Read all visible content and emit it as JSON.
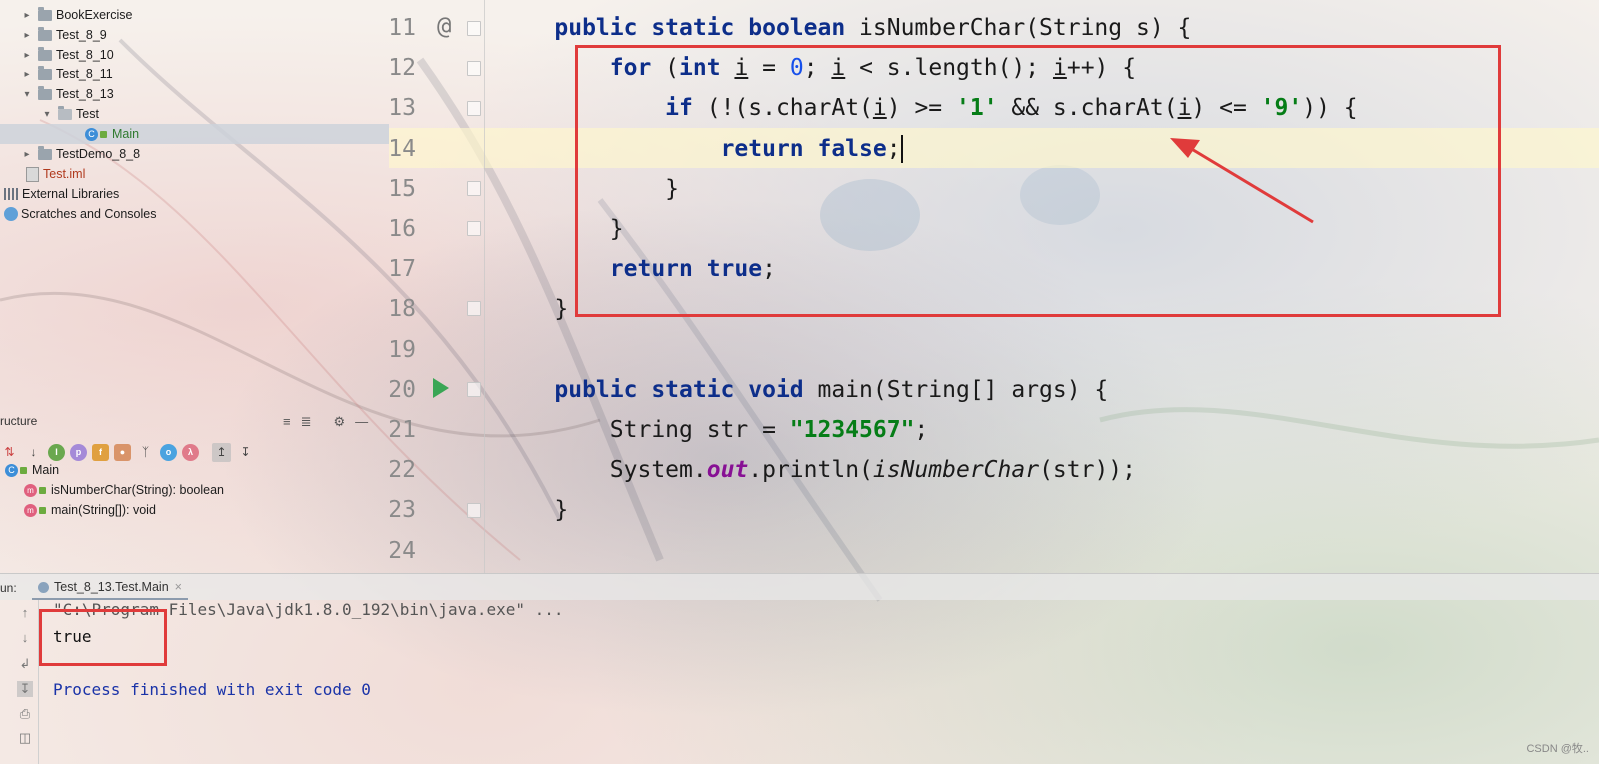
{
  "project_tree": {
    "items": [
      {
        "label": "BookExercise",
        "type": "folder",
        "expanded": false
      },
      {
        "label": "Test_8_9",
        "type": "folder",
        "expanded": false
      },
      {
        "label": "Test_8_10",
        "type": "folder",
        "expanded": false
      },
      {
        "label": "Test_8_11",
        "type": "folder",
        "expanded": false
      },
      {
        "label": "Test_8_13",
        "type": "folder",
        "expanded": true
      },
      {
        "label": "Test",
        "type": "package",
        "expanded": true
      },
      {
        "label": "Main",
        "type": "class",
        "selected": true
      },
      {
        "label": "TestDemo_8_8",
        "type": "folder",
        "expanded": false
      },
      {
        "label": "Test.iml",
        "type": "file"
      },
      {
        "label": "External Libraries",
        "type": "libraries"
      },
      {
        "label": "Scratches and Consoles",
        "type": "scratches"
      }
    ]
  },
  "structure": {
    "title": "ructure",
    "class_name": "Main",
    "members": [
      {
        "label": "isNumberChar(String): boolean",
        "icon": "m"
      },
      {
        "label": "main(String[]): void",
        "icon": "m"
      }
    ],
    "toolbar_icons": [
      "sort-alpha-icon",
      "sort-visibility-icon",
      "show-inherited-icon",
      "show-properties-icon",
      "show-fields-icon",
      "show-non-public-icon",
      "show-lambdas-icon",
      "anonymous-classes-icon",
      "lambda-icon",
      "autoscroll-to-source-icon",
      "autoscroll-from-source-icon"
    ]
  },
  "editor": {
    "lines": [
      {
        "num": "11",
        "text": "    public static boolean isNumberChar(String s) {"
      },
      {
        "num": "12",
        "text": "        for (int i = 0; i < s.length(); i++) {"
      },
      {
        "num": "13",
        "text": "            if (!(s.charAt(i) >= '1' && s.charAt(i) <= '9')) {"
      },
      {
        "num": "14",
        "text": "                return false;"
      },
      {
        "num": "15",
        "text": "            }"
      },
      {
        "num": "16",
        "text": "        }"
      },
      {
        "num": "17",
        "text": "        return true;"
      },
      {
        "num": "18",
        "text": "    }"
      },
      {
        "num": "19",
        "text": ""
      },
      {
        "num": "20",
        "text": "    public static void main(String[] args) {"
      },
      {
        "num": "21",
        "text": "        String str = \"1234567\";"
      },
      {
        "num": "22",
        "text": "        System.out.println(isNumberChar(str));"
      },
      {
        "num": "23",
        "text": "    }"
      },
      {
        "num": "24",
        "text": ""
      }
    ],
    "gutter_marks": {
      "override": "@"
    }
  },
  "run": {
    "label": "un:",
    "tab_label": "Test_8_13.Test.Main",
    "console": [
      {
        "text": "\"C:\\Program Files\\Java\\jdk1.8.0_192\\bin\\java.exe\" ..."
      },
      {
        "text": "true"
      },
      {
        "text": "Process finished with exit code 0"
      }
    ]
  },
  "watermark": "CSDN @牧..",
  "colors": {
    "keyword": "#0d2e8a",
    "string": "#067d17",
    "number": "#1750eb",
    "annotation": "#e03b3b"
  }
}
